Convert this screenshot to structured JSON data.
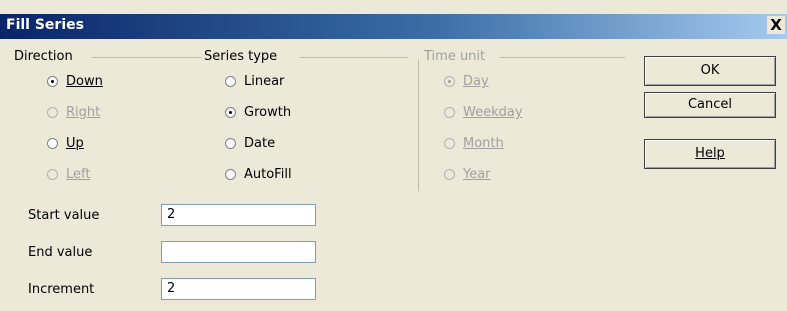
{
  "window": {
    "title": "Fill Series",
    "close_label": "X"
  },
  "direction": {
    "title": "Direction",
    "options": [
      {
        "label": "Down",
        "selected": true,
        "disabled": false
      },
      {
        "label": "Right",
        "selected": false,
        "disabled": true
      },
      {
        "label": "Up",
        "selected": false,
        "disabled": false
      },
      {
        "label": "Left",
        "selected": false,
        "disabled": true
      }
    ]
  },
  "series_type": {
    "title": "Series type",
    "options": [
      {
        "label": "Linear",
        "selected": false,
        "disabled": false
      },
      {
        "label": "Growth",
        "selected": true,
        "disabled": false
      },
      {
        "label": "Date",
        "selected": false,
        "disabled": false
      },
      {
        "label": "AutoFill",
        "selected": false,
        "disabled": false
      }
    ]
  },
  "time_unit": {
    "title": "Time unit",
    "options": [
      {
        "label": "Day",
        "selected": true,
        "disabled": true
      },
      {
        "label": "Weekday",
        "selected": false,
        "disabled": true
      },
      {
        "label": "Month",
        "selected": false,
        "disabled": true
      },
      {
        "label": "Year",
        "selected": false,
        "disabled": true
      }
    ]
  },
  "fields": {
    "start_label": "Start value",
    "start_value": "2",
    "end_label": "End value",
    "end_value": "",
    "increment_label": "Increment",
    "increment_value": "2"
  },
  "buttons": {
    "ok": "OK",
    "cancel": "Cancel",
    "help": "Help"
  }
}
